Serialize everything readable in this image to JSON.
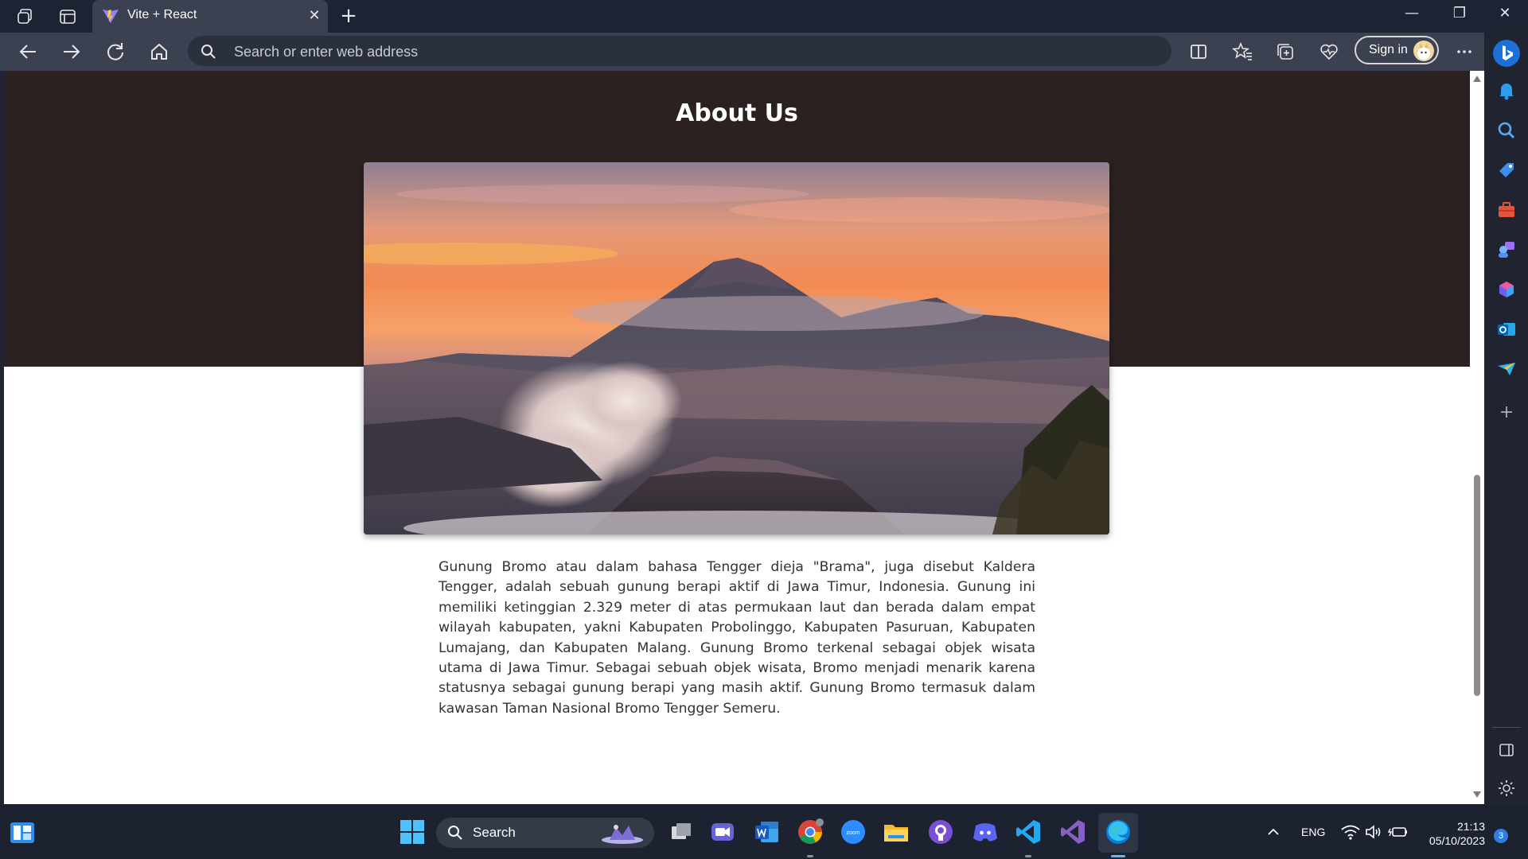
{
  "browser": {
    "tab_title": "Vite + React",
    "address_placeholder": "Search or enter web address",
    "signin_label": "Sign in"
  },
  "page": {
    "title": "About Us",
    "body": "Gunung Bromo atau dalam bahasa Tengger dieja \"Brama\", juga disebut Kaldera Tengger, adalah sebuah gunung berapi aktif di Jawa Timur, Indonesia. Gunung ini memiliki ketinggian 2.329 meter di atas permukaan laut dan berada dalam empat wilayah kabupaten, yakni Kabupaten Probolinggo, Kabupaten Pasuruan, Kabupaten Lumajang, dan Kabupaten Malang. Gunung Bromo terkenal sebagai objek wisata utama di Jawa Timur. Sebagai sebuah objek wisata, Bromo menjadi menarik karena statusnya sebagai gunung berapi yang masih aktif. Gunung Bromo termasuk dalam kawasan Taman Nasional Bromo Tengger Semeru."
  },
  "taskbar": {
    "search_label": "Search",
    "language": "ENG",
    "time": "21:13",
    "date": "05/10/2023",
    "notification_count": "3"
  },
  "colors": {
    "hero_band": "#2b2120",
    "browser_chrome": "#3b4150",
    "titlebar": "#1c2333",
    "taskbar": "#1c2230",
    "accent": "#2f7fe0"
  }
}
